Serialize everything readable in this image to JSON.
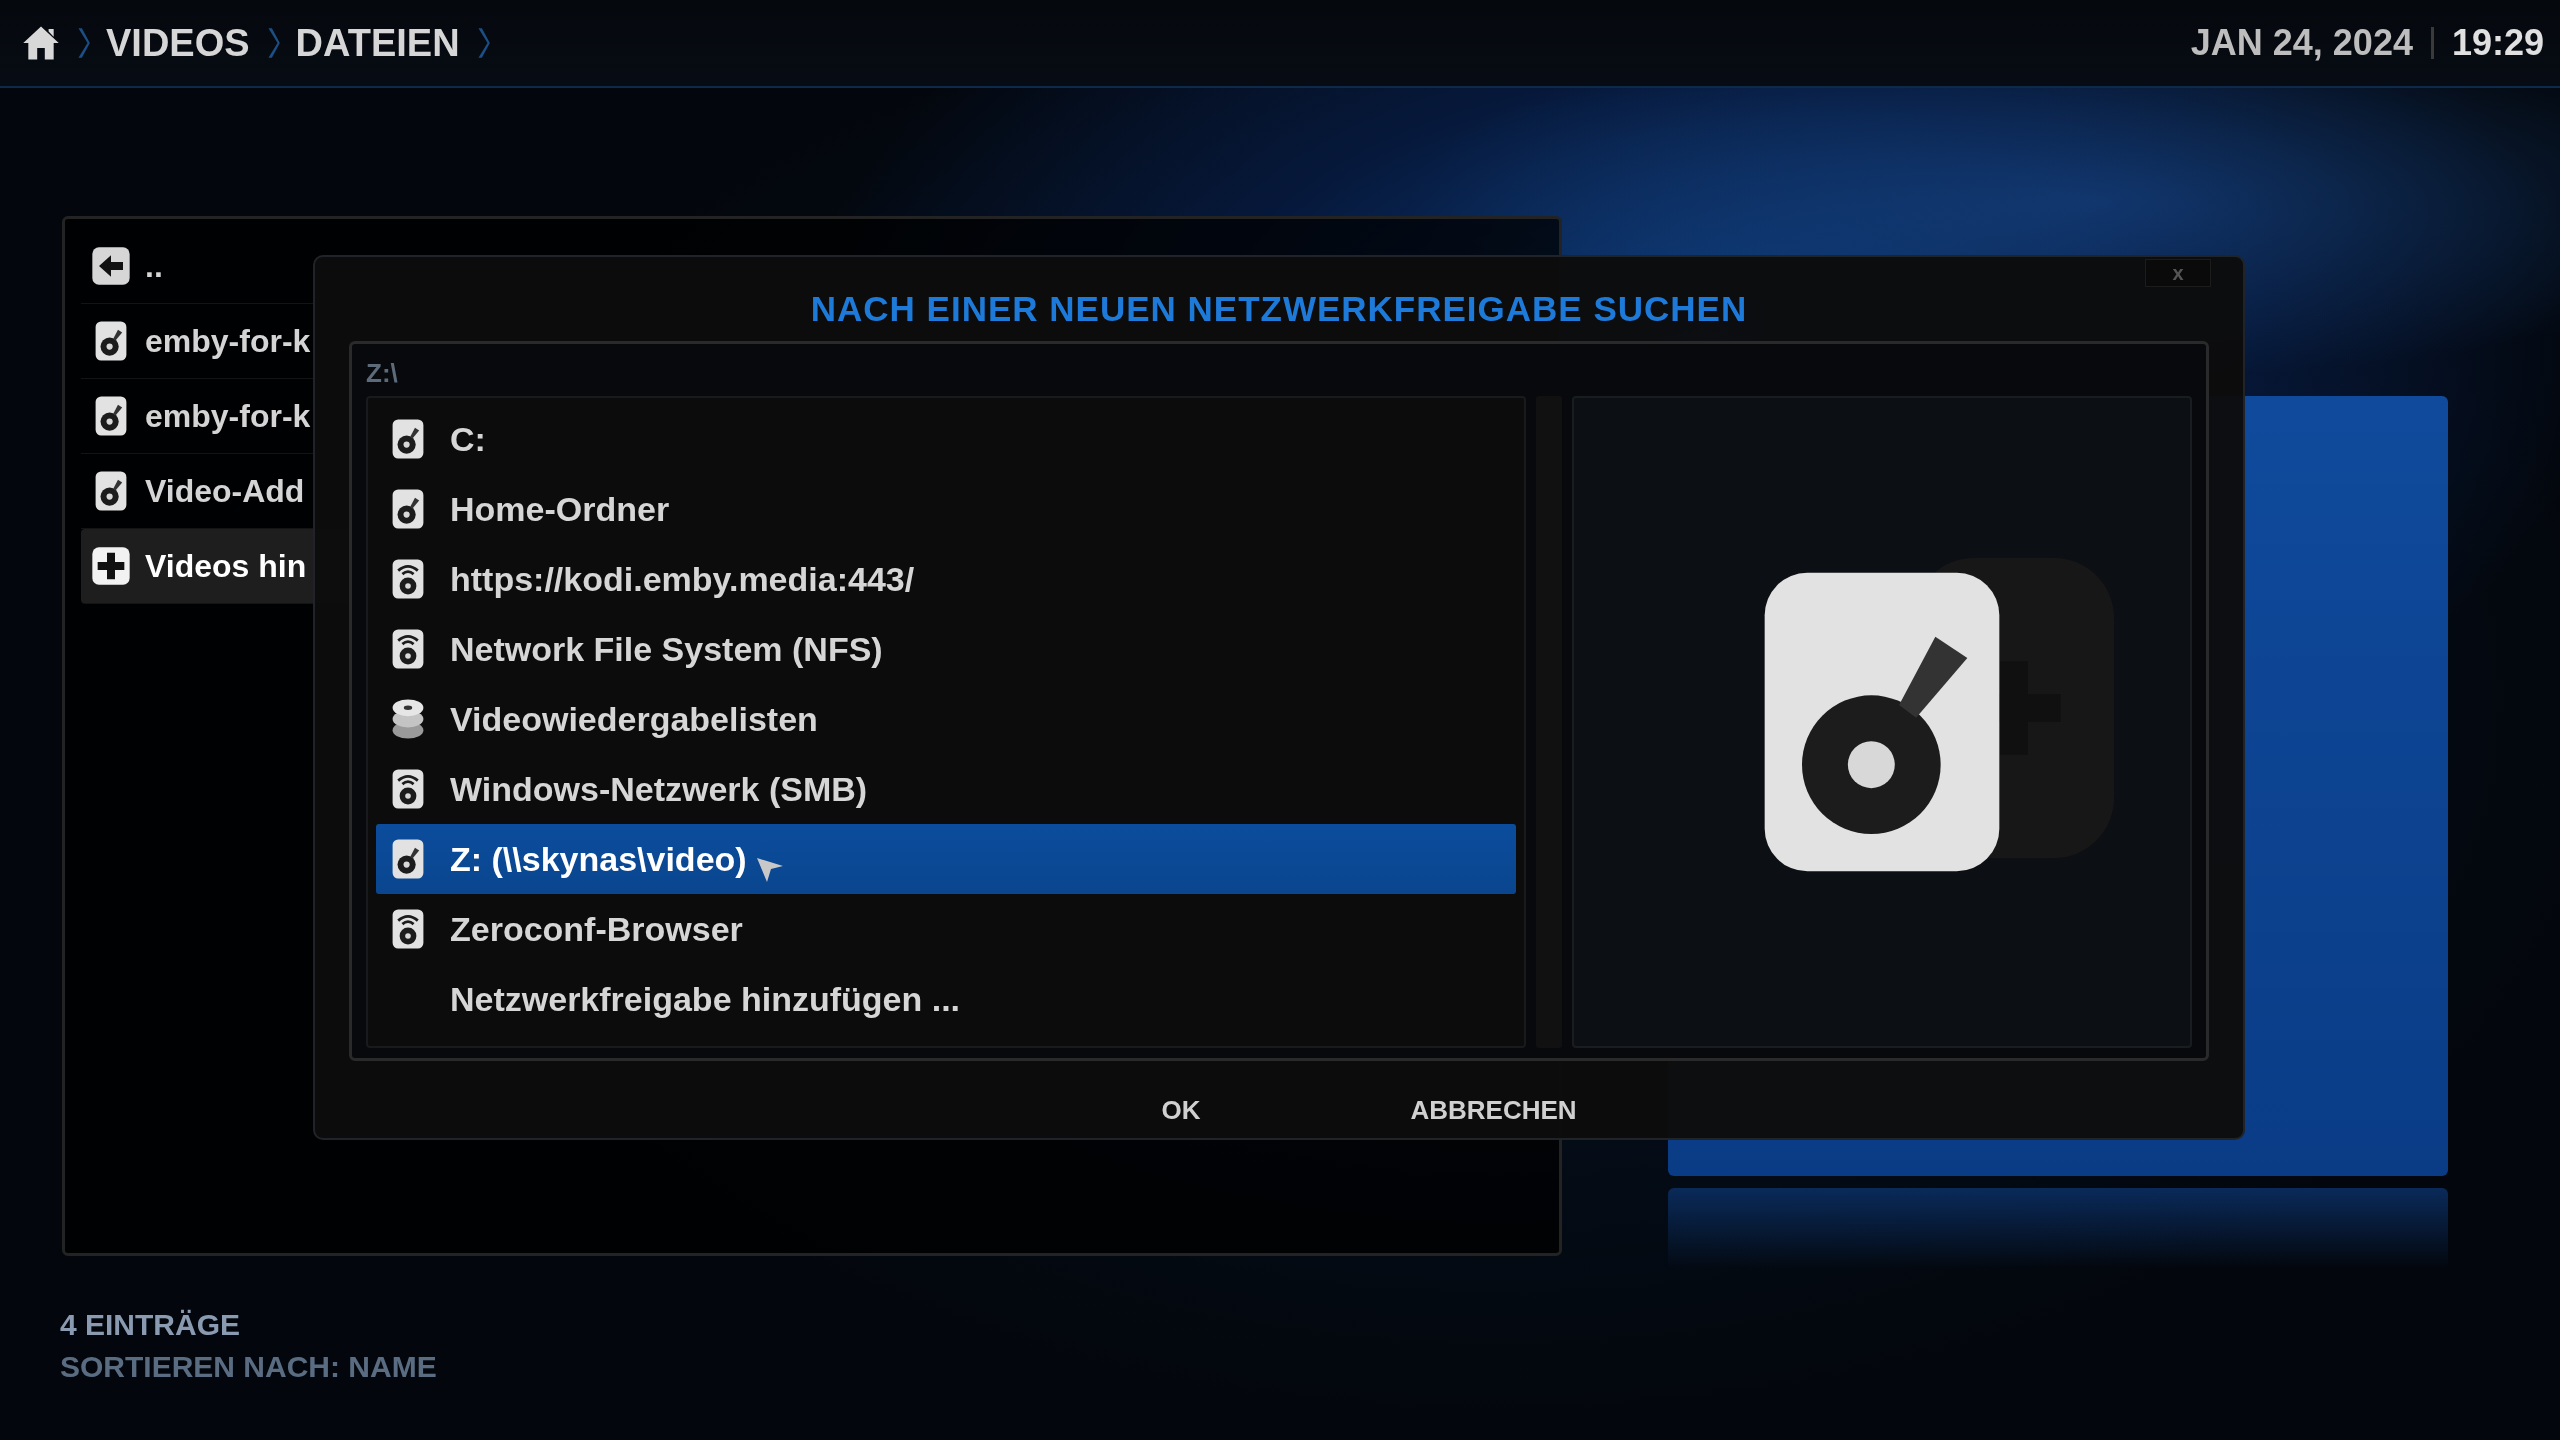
{
  "breadcrumb": {
    "items": [
      {
        "label": "VIDEOS"
      },
      {
        "label": "DATEIEN"
      }
    ]
  },
  "clock": {
    "date": "JAN 24, 2024",
    "time": "19:29"
  },
  "file_list": {
    "items": [
      {
        "label": "..",
        "kind": "back",
        "selected": false
      },
      {
        "label": "emby-for-k",
        "kind": "disk",
        "selected": false
      },
      {
        "label": "emby-for-k",
        "kind": "disk",
        "selected": false
      },
      {
        "label": "Video-Add",
        "kind": "disk",
        "selected": false
      },
      {
        "label": "Videos hin",
        "kind": "add",
        "selected": true
      }
    ]
  },
  "dialog": {
    "title": "NACH EINER NEUEN NETZWERKFREIGABE SUCHEN",
    "close": "x",
    "path": "Z:\\",
    "sources": [
      {
        "label": "C:",
        "kind": "disk",
        "selected": false
      },
      {
        "label": "Home-Ordner",
        "kind": "disk",
        "selected": false
      },
      {
        "label": "https://kodi.emby.media:443/",
        "kind": "network",
        "selected": false
      },
      {
        "label": "Network File System (NFS)",
        "kind": "network",
        "selected": false
      },
      {
        "label": "Videowiedergabelisten",
        "kind": "playlist",
        "selected": false
      },
      {
        "label": "Windows-Netzwerk (SMB)",
        "kind": "network",
        "selected": false
      },
      {
        "label": "Z: (\\\\skynas\\video)",
        "kind": "disk",
        "selected": true
      },
      {
        "label": "Zeroconf-Browser",
        "kind": "network",
        "selected": false
      },
      {
        "label": "Netzwerkfreigabe hinzufügen ...",
        "kind": "none",
        "selected": false
      }
    ],
    "buttons": [
      {
        "label": "OK"
      },
      {
        "label": "ABBRECHEN"
      }
    ]
  },
  "footer": {
    "count": "4 EINTRÄGE",
    "sort": "SORTIEREN NACH: NAME"
  }
}
